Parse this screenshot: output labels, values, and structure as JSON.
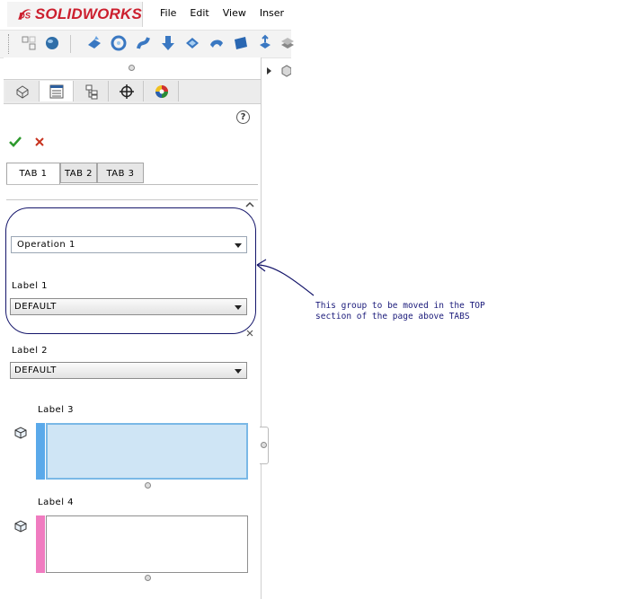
{
  "app": {
    "brand_ds": "DS",
    "brand_name_solid": "SOLID",
    "brand_name_works": "WORKS"
  },
  "menu": {
    "items": [
      {
        "label": "File"
      },
      {
        "label": "Edit"
      },
      {
        "label": "View"
      },
      {
        "label": "Inser"
      }
    ]
  },
  "property_manager": {
    "help_label": "?",
    "tabs": [
      {
        "label": "TAB 1"
      },
      {
        "label": "TAB 2"
      },
      {
        "label": "TAB 3"
      }
    ],
    "operation_combo": {
      "value": "Operation 1"
    },
    "label1": {
      "text": "Label 1",
      "value": "DEFAULT"
    },
    "label2": {
      "text": "Label 2",
      "value": "DEFAULT"
    },
    "label3": {
      "text": "Label 3"
    },
    "label4": {
      "text": "Label 4"
    }
  },
  "annotation": {
    "line1": "This group to be moved in the TOP",
    "line2": "section of the page above TABS",
    "color": "#15166b"
  },
  "colors": {
    "brand_red": "#cc1f2e",
    "selection_blue": "#cfe5f5",
    "strip_blue": "#5aa9ea",
    "strip_pink": "#f07cc0"
  }
}
